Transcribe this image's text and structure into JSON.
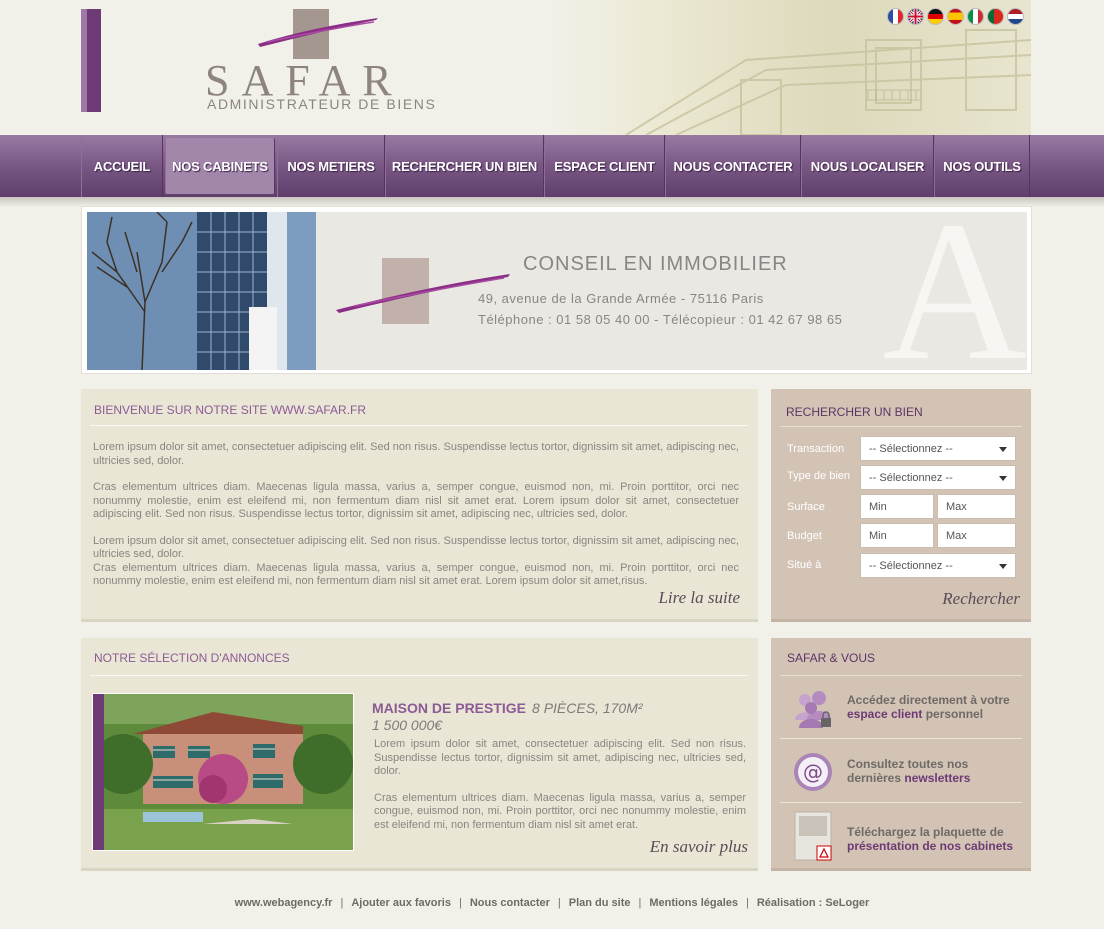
{
  "header": {
    "logo_name": "SAFAR",
    "logo_tagline": "ADMINISTRATEUR DE BIENS",
    "flags": [
      "french-flag-icon",
      "uk-flag-icon",
      "german-flag-icon",
      "spanish-flag-icon",
      "italian-flag-icon",
      "portuguese-flag-icon",
      "dutch-flag-icon"
    ]
  },
  "nav": {
    "items": [
      {
        "label": "ACCUEIL",
        "name": "nav-accueil",
        "active": false
      },
      {
        "label": "NOS CABINETS",
        "name": "nav-nos-cabinets",
        "active": true
      },
      {
        "label": "NOS METIERS",
        "name": "nav-nos-metiers",
        "active": false
      },
      {
        "label": "RECHERCHER UN BIEN",
        "name": "nav-rechercher-un-bien",
        "active": false
      },
      {
        "label": "ESPACE CLIENT",
        "name": "nav-espace-client",
        "active": false
      },
      {
        "label": "NOUS CONTACTER",
        "name": "nav-nous-contacter",
        "active": false
      },
      {
        "label": "NOUS LOCALISER",
        "name": "nav-nous-localiser",
        "active": false
      },
      {
        "label": "NOS OUTILS",
        "name": "nav-nos-outils",
        "active": false
      }
    ]
  },
  "banner": {
    "title": "CONSEIL EN IMMOBILIER",
    "address": "49, avenue de la Grande Armée - 75116 Paris",
    "phone": "Téléphone : 01 58 05 40 00 - Télécopieur : 01 42 67 98 65"
  },
  "welcome": {
    "title": "BIENVENUE SUR NOTRE SITE WWW.SAFAR.FR",
    "p1": "Lorem ipsum dolor sit amet, consectetuer adipiscing elit. Sed non risus. Suspendisse lectus tortor, dignissim sit amet, adipiscing nec, ultricies sed, dolor.",
    "p2": "Cras elementum ultrices diam. Maecenas ligula massa, varius a, semper congue, euismod non, mi. Proin porttitor, orci nec nonummy molestie, enim est eleifend mi, non fermentum diam nisl sit amet erat. Lorem ipsum dolor sit amet, consectetuer adipiscing elit. Sed non risus. Suspendisse lectus tortor, dignissim sit amet, adipiscing nec, ultricies sed, dolor.",
    "p3": "Lorem ipsum dolor sit amet, consectetuer adipiscing elit. Sed non risus. Suspendisse lectus tortor, dignissim sit amet, adipiscing nec, ultricies sed, dolor.",
    "p4": "Cras elementum ultrices diam. Maecenas ligula massa, varius a, semper congue, euismod non, mi. Proin porttitor, orci nec nonummy molestie, enim est eleifend mi, non fermentum diam nisl sit amet erat. Lorem ipsum dolor sit amet,risus.",
    "more_link": "Lire la suite"
  },
  "search": {
    "title": "RECHERCHER UN BIEN",
    "transaction_label": "Transaction",
    "transaction_value": "-- Sélectionnez --",
    "type_label": "Type de bien",
    "type_value": "-- Sélectionnez --",
    "surface_label": "Surface",
    "surface_min": "Min",
    "surface_max": "Max",
    "budget_label": "Budget",
    "budget_min": "Min",
    "budget_max": "Max",
    "location_label": "Situé à",
    "location_value": "-- Sélectionnez --",
    "submit": "Rechercher"
  },
  "ads": {
    "title": "NOTRE SÉLECTION D'ANNONCES",
    "listing_title": "MAISON DE PRESTIGE",
    "listing_details": "8 PIÈCES, 170M²",
    "listing_price": "1 500 000€",
    "p1": "Lorem ipsum dolor sit amet, consectetuer adipiscing elit. Sed non risus. Suspendisse lectus tortor, dignissim sit amet, adipiscing nec, ultricies sed, dolor.",
    "p2": "Cras elementum ultrices diam. Maecenas ligula massa, varius a, semper congue, euismod non, mi. Proin porttitor, orci nec nonummy molestie, enim est eleifend mi, non fermentum diam nisl sit amet erat.",
    "more_link": "En savoir plus"
  },
  "safar_vous": {
    "title": "SAFAR & VOUS",
    "item1_pre": "Accédez directement à votre",
    "item1_hl": "espace client",
    "item1_post": " personnel",
    "item2_pre": "Consultez toutes nos",
    "item2_line2": "dernières ",
    "item2_hl": "newsletters",
    "item3_pre": "Téléchargez la plaquette de",
    "item3_hl": "présentation de nos cabinets"
  },
  "footer": {
    "links": [
      "www.webagency.fr",
      "Ajouter aux favoris",
      "Nous contacter",
      "Plan du site",
      "Mentions légales",
      "Réalisation : SeLoger"
    ]
  },
  "colors": {
    "accent_purple": "#6e3a76",
    "nav_purple": "#7b5a86",
    "panel_beige": "#e9e6d6",
    "sidebar_taupe": "#d2c3b5"
  }
}
